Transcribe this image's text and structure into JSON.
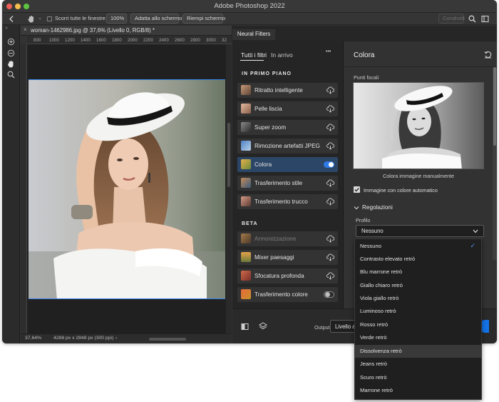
{
  "app": {
    "window_title": "Adobe Photoshop 2022"
  },
  "options_bar": {
    "scroll_all_label": "Scorri tutte le finestre",
    "zoom_button": "100%",
    "fit_button": "Adatta allo schermo",
    "fill_button": "Riempi schermo",
    "share_label": "Condividi"
  },
  "document": {
    "tab_title": "woman-1462986.jpg @ 37,6% (Livello 0, RGB/8) *",
    "ruler_ticks": [
      "800",
      "1000",
      "1200",
      "1400",
      "1600",
      "1800",
      "2000",
      "2200",
      "2400",
      "2600",
      "2800",
      "3000",
      "32"
    ],
    "zoom_level": "37,64%",
    "doc_info": "4288 px x 2848 px (300 ppi)"
  },
  "neural_filters": {
    "panel_tab": "Neural Filters",
    "tabs": [
      "Tutti i filtri",
      "In arrivo"
    ],
    "more_label": "•••",
    "featured_section": "IN PRIMO PIANO",
    "featured": [
      {
        "label": "Ritratto intelligente",
        "state": "cloud"
      },
      {
        "label": "Pelle liscia",
        "state": "cloud"
      },
      {
        "label": "Super zoom",
        "state": "cloud"
      },
      {
        "label": "Rimozione artefatti JPEG",
        "state": "cloud"
      },
      {
        "label": "Colora",
        "state": "toggle-on"
      },
      {
        "label": "Trasferimento stile",
        "state": "cloud"
      },
      {
        "label": "Trasferimento trucco",
        "state": "cloud"
      }
    ],
    "beta_section": "BETA",
    "beta": [
      {
        "label": "Armonizzazione",
        "state": "cloud"
      },
      {
        "label": "Mixer paesaggi",
        "state": "cloud"
      },
      {
        "label": "Sfocatura profonda",
        "state": "cloud"
      },
      {
        "label": "Trasferimento colore",
        "state": "toggle-off"
      }
    ]
  },
  "settings": {
    "title": "Colora",
    "focal_points_label": "Punti focali",
    "caption": "Colora immagine manualmente",
    "auto_color_label": "Immagine con colore automatico",
    "auto_color_checked": true,
    "adjustments_label": "Regolazioni",
    "profile_label": "Profilo",
    "profile_value": "Nessuno",
    "profile_options": [
      "Nessuno",
      "Contrasto elevato retrò",
      "Blu marrone retrò",
      "Giallo chiaro retrò",
      "Viola giallo retrò",
      "Luminoso retrò",
      "Rosso retrò",
      "Verde retrò",
      "Dissolvenza retrò",
      "Jeans retrò",
      "Scuro retrò",
      "Marrone retrò"
    ],
    "hovered_option": "Dissolvenza retrò"
  },
  "output": {
    "label": "Output",
    "value": "Livello al"
  },
  "colors": {
    "accent": "#1473e6",
    "selected_filter": "#2c4667",
    "panel_bg": "#323232"
  }
}
